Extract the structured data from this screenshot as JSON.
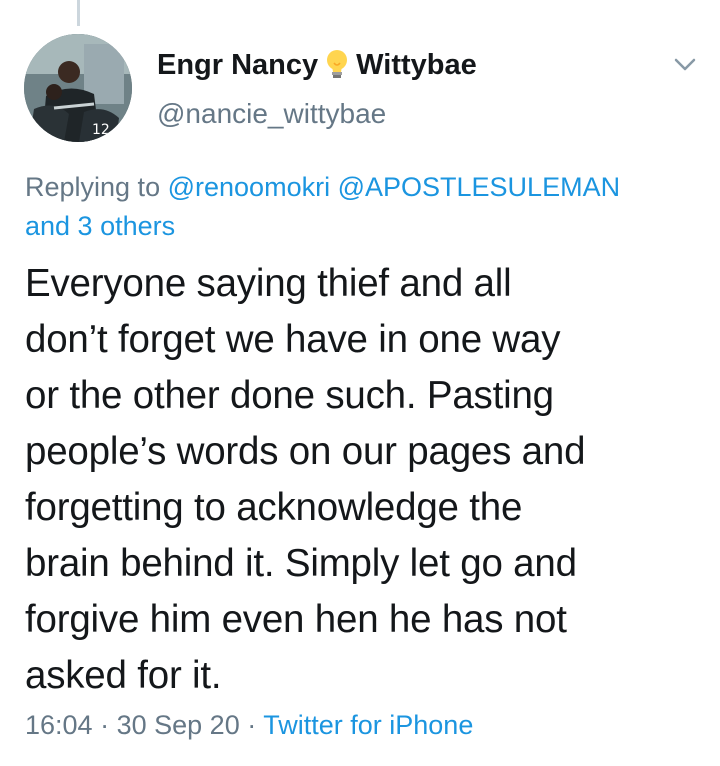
{
  "tweet": {
    "author": {
      "name_part1": "Engr Nancy",
      "name_part2": "Wittybae",
      "handle": "@nancie_wittybae"
    },
    "reply_context": {
      "prefix": "Replying to",
      "mentions": [
        "@renoomokri",
        "@APOSTLESULEMAN"
      ],
      "others": "and 3 others"
    },
    "text": "Everyone saying thief and all\ndon’t forget we have in one way\nor the other done such. Pasting\npeople’s words on our pages and\nforgetting to acknowledge the\nbrain behind it. Simply let go and\nforgive him even  hen he has not\nasked for it.",
    "time": "16:04",
    "date": "30 Sep 20",
    "separator": "·",
    "source": "Twitter for iPhone"
  },
  "icons": {
    "name_emoji": "light-bulb-icon",
    "menu": "chevron-down-icon"
  },
  "colors": {
    "link": "#1b95e0",
    "secondary_text": "#657786",
    "primary_text": "#14171a",
    "thread_line": "#ccd6dd"
  }
}
